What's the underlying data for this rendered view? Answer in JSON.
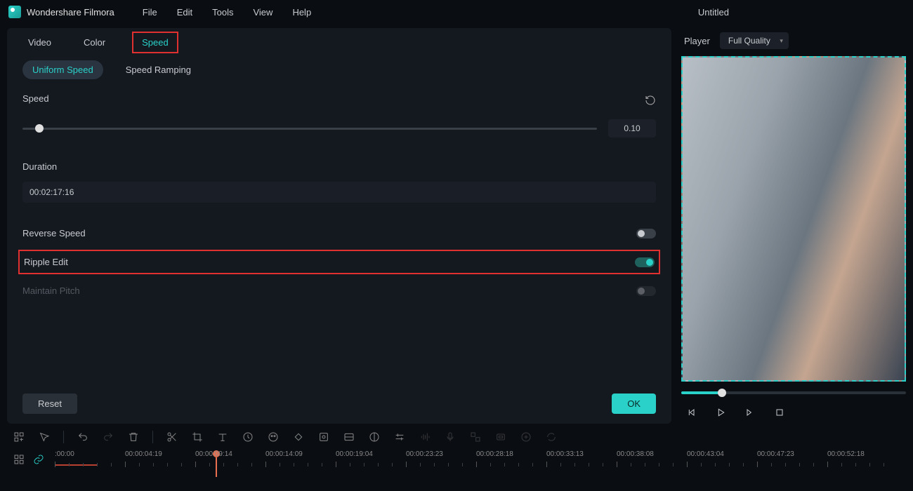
{
  "app": {
    "name": "Wondershare Filmora",
    "document": "Untitled"
  },
  "menu": [
    "File",
    "Edit",
    "Tools",
    "View",
    "Help"
  ],
  "prop_tabs": [
    "Video",
    "Color",
    "Speed"
  ],
  "sub_tabs": [
    "Uniform Speed",
    "Speed Ramping"
  ],
  "speed": {
    "label": "Speed",
    "value": "0.10"
  },
  "duration": {
    "label": "Duration",
    "value": "00:02:17:16"
  },
  "toggles": {
    "reverse": "Reverse Speed",
    "ripple": "Ripple Edit",
    "pitch": "Maintain Pitch"
  },
  "buttons": {
    "reset": "Reset",
    "ok": "OK"
  },
  "player": {
    "label": "Player",
    "quality": "Full Quality"
  },
  "timecodes": [
    ":00:00",
    "00:00:04:19",
    "00:00:09:14",
    "00:00:14:09",
    "00:00:19:04",
    "00:00:23:23",
    "00:00:28:18",
    "00:00:33:13",
    "00:00:38:08",
    "00:00:43:04",
    "00:00:47:23",
    "00:00:52:18"
  ]
}
